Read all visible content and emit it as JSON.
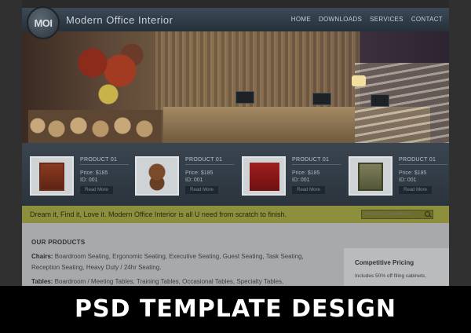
{
  "header": {
    "logo": "MOI",
    "brand": "Modern Office Interior",
    "nav": [
      "HOME",
      "DOWNLOADS",
      "SERVICES",
      "CONTACT"
    ]
  },
  "products": [
    {
      "title": "PRODUCT 01",
      "price": "Price: $185",
      "id": "ID: 001",
      "button": "Read More"
    },
    {
      "title": "PRODUCT 01",
      "price": "Price: $185",
      "id": "ID: 001",
      "button": "Read More"
    },
    {
      "title": "PRODUCT 01",
      "price": "Price: $185",
      "id": "ID: 001",
      "button": "Read More"
    },
    {
      "title": "PRODUCT 01",
      "price": "Price: $185",
      "id": "ID: 001",
      "button": "Read More"
    }
  ],
  "tagline": "Dream it, Find it, Love it. Modern Office Interior is all U need from scratch to finish.",
  "search": {
    "placeholder": "PRODUCT SEARCH"
  },
  "content": {
    "heading": "OUR PRODUCTS",
    "chairs_label": "Chairs:",
    "chairs_text": "Boardroom Seating, Ergonomic Seating, Executive Seating, Guest Seating, Task Seating,",
    "chairs_text2": "Reception Seating, Heavy Duty / 24hr Seating.",
    "tables_label": "Tables:",
    "tables_text": "Boardroom / Meeting Tables, Training Tables, Occasional Tables, Specialty Tables,"
  },
  "sidebar": {
    "title": "Competitive Pricing",
    "text": "Includes 50% off filing cabinets,"
  },
  "banner": "PSD TEMPLATE DESIGN"
}
